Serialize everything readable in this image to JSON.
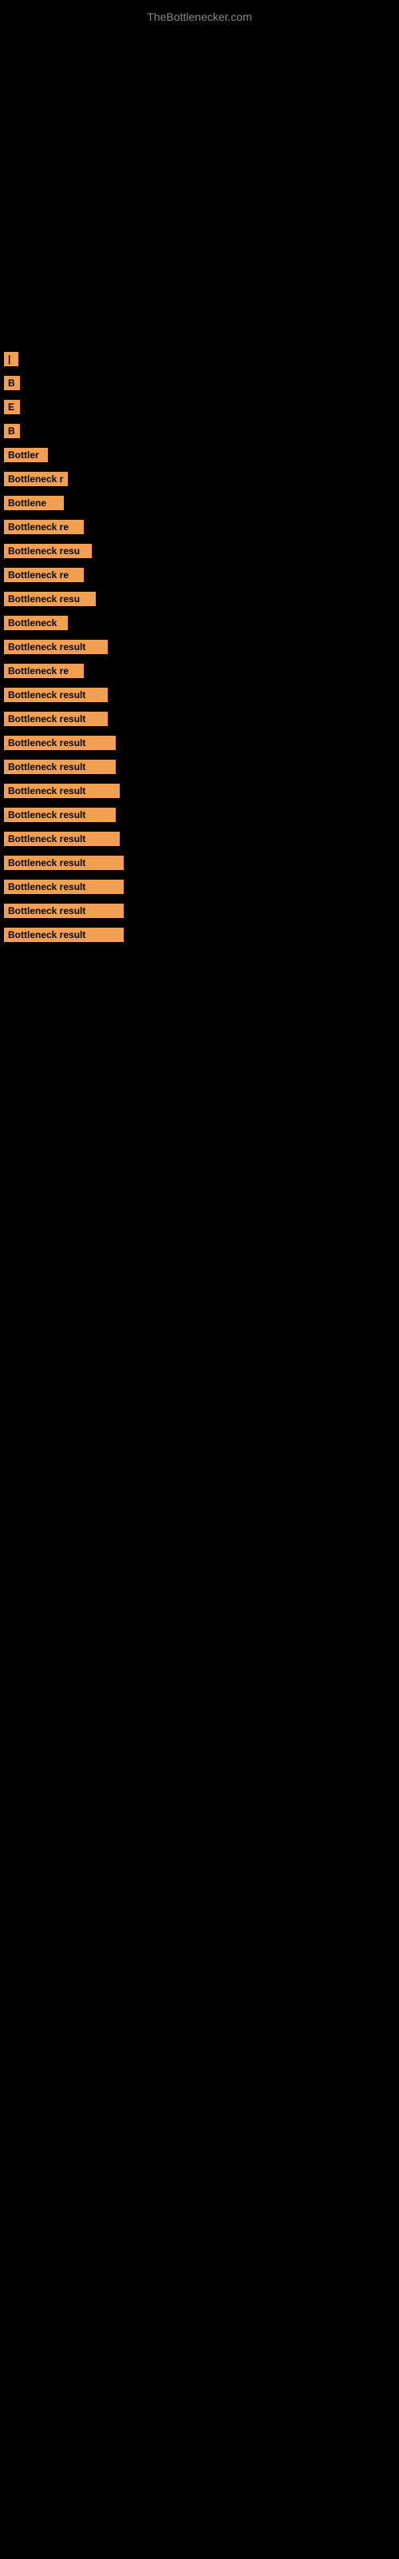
{
  "site": {
    "title": "TheBottlenecker.com"
  },
  "labels": [
    {
      "id": "label-0",
      "text": "|",
      "class": "label-small-1"
    },
    {
      "id": "label-1",
      "text": "B",
      "class": "label-small-2"
    },
    {
      "id": "label-2",
      "text": "E",
      "class": "label-small-2"
    },
    {
      "id": "label-3",
      "text": "B",
      "class": "label-small-3"
    },
    {
      "id": "label-4",
      "text": "Bottler",
      "class": "label-medium-1"
    },
    {
      "id": "label-5",
      "text": "Bottleneck r",
      "class": "label-medium-2"
    },
    {
      "id": "label-6",
      "text": "Bottlene",
      "class": "label-medium-3"
    },
    {
      "id": "label-7",
      "text": "Bottleneck re",
      "class": "label-medium-4"
    },
    {
      "id": "label-8",
      "text": "Bottleneck resu",
      "class": "label-medium-5"
    },
    {
      "id": "label-9",
      "text": "Bottleneck re",
      "class": "label-medium-6"
    },
    {
      "id": "label-10",
      "text": "Bottleneck resu",
      "class": "label-medium-7"
    },
    {
      "id": "label-11",
      "text": "Bottleneck",
      "class": "label-medium-8"
    },
    {
      "id": "label-12",
      "text": "Bottleneck result",
      "class": "label-large-1"
    },
    {
      "id": "label-13",
      "text": "Bottleneck re",
      "class": "label-large-2"
    },
    {
      "id": "label-14",
      "text": "Bottleneck result",
      "class": "label-large-3"
    },
    {
      "id": "label-15",
      "text": "Bottleneck result",
      "class": "label-large-4"
    },
    {
      "id": "label-16",
      "text": "Bottleneck result",
      "class": "label-large-5"
    },
    {
      "id": "label-17",
      "text": "Bottleneck result",
      "class": "label-large-6"
    },
    {
      "id": "label-18",
      "text": "Bottleneck result",
      "class": "label-large-7"
    },
    {
      "id": "label-19",
      "text": "Bottleneck result",
      "class": "label-large-8"
    },
    {
      "id": "label-20",
      "text": "Bottleneck result",
      "class": "label-large-9"
    },
    {
      "id": "label-21",
      "text": "Bottleneck result",
      "class": "label-large-10"
    },
    {
      "id": "label-22",
      "text": "Bottleneck result",
      "class": "label-large-11"
    },
    {
      "id": "label-23",
      "text": "Bottleneck result",
      "class": "label-large-12"
    },
    {
      "id": "label-24",
      "text": "Bottleneck result",
      "class": "label-large-13"
    }
  ]
}
